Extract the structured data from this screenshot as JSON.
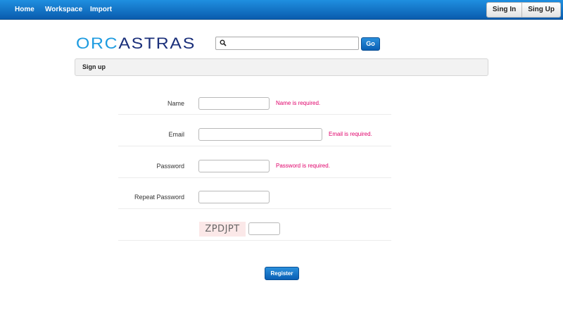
{
  "nav": {
    "home": "Home",
    "workspace": "Workspace",
    "import": "Import"
  },
  "auth": {
    "sign_in": "Sing In",
    "sign_up": "Sing Up"
  },
  "logo": {
    "text": "ORCASTRAS"
  },
  "search": {
    "value": "",
    "placeholder": "",
    "go_label": "Go"
  },
  "section": {
    "title": "Sign up"
  },
  "form": {
    "name_label": "Name",
    "name_error": "Name is required.",
    "email_label": "Email",
    "email_error": "Email is required.",
    "password_label": "Password",
    "password_error": "Password is required.",
    "repeat_password_label": "Repeat Password",
    "captcha_text": "ZPDJPT",
    "register_label": "Register"
  },
  "colors": {
    "topbar": "#0d6fc6",
    "error": "#e0006a",
    "logo_dark": "#1a2f7a",
    "logo_light": "#1d9be0"
  }
}
